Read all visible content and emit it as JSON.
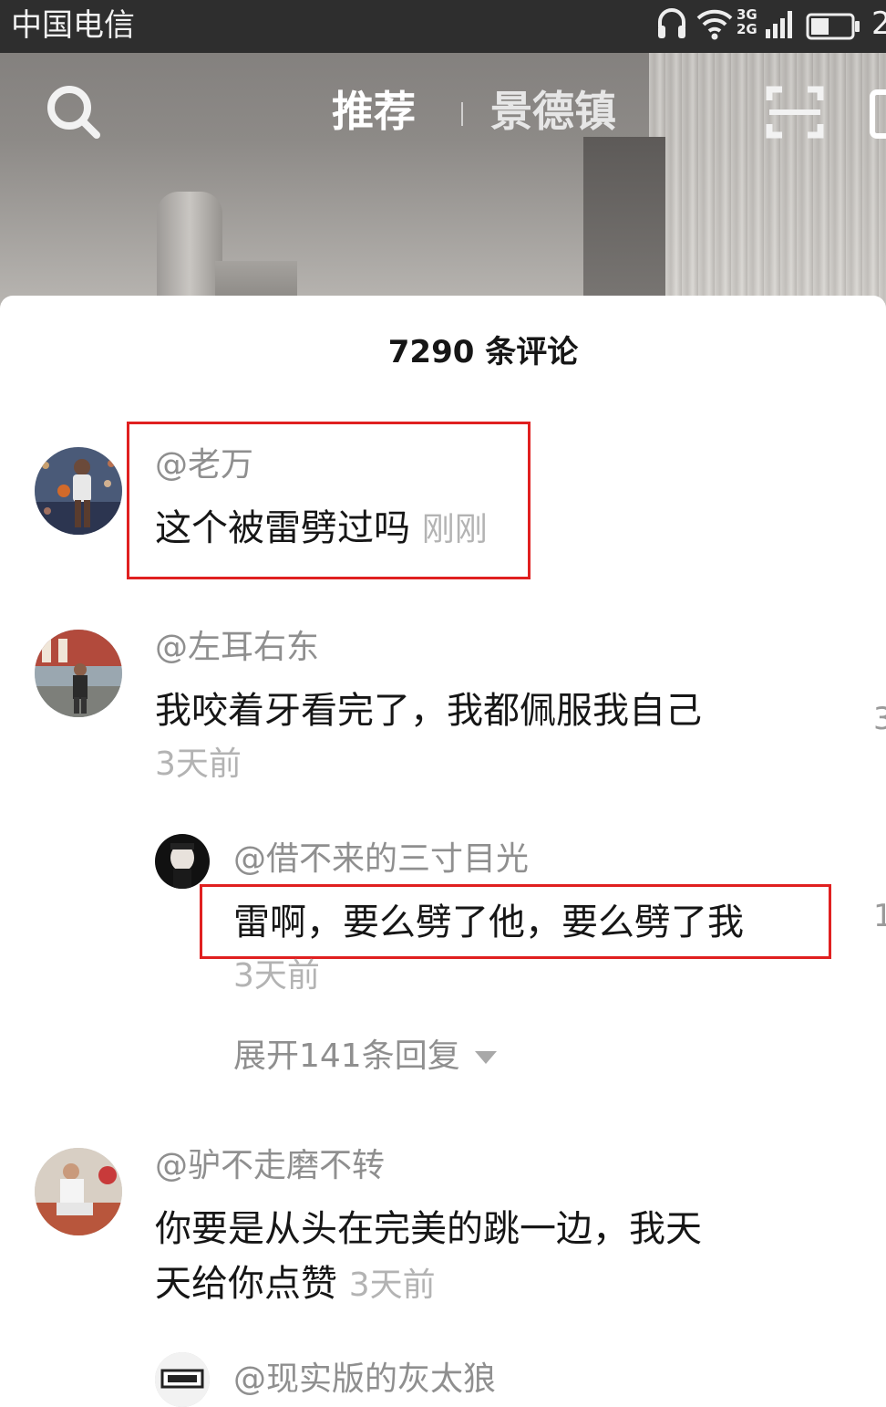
{
  "status_bar": {
    "carrier": "中国电信",
    "network": [
      "3G",
      "2G"
    ],
    "battery_fraction": 0.45,
    "clock_partial": "2"
  },
  "nav": {
    "tabs": [
      {
        "label": "推荐",
        "active": true
      },
      {
        "label": "景德镇",
        "active": false
      }
    ],
    "icons": [
      "search-icon",
      "scan-icon"
    ]
  },
  "comments_panel": {
    "title": "7290 条评论",
    "comments": [
      {
        "user": "@老万",
        "text": "这个被雷劈过吗",
        "time": "刚刚",
        "highlighted": true
      },
      {
        "user": "@左耳右东",
        "text": "我咬着牙看完了，我都佩服我自己",
        "time": "3天前",
        "reply": {
          "user": "@借不来的三寸目光",
          "text": "雷啊，要么劈了他，要么劈了我",
          "time": "3天前",
          "highlighted": true
        },
        "expand_label": "展开141条回复"
      },
      {
        "user": "@驴不走磨不转",
        "text_line1": "你要是从头在完美的跳一边，我天",
        "text_line2": "天给你点赞",
        "time": "3天前"
      },
      {
        "user": "@现实版的灰太狼"
      }
    ],
    "edge_like_counts": [
      "3",
      "1"
    ]
  },
  "colors": {
    "highlight_box": "#e02020",
    "username": "#8f8f8f",
    "timestamp": "#b3b3b3",
    "text": "#161616"
  }
}
